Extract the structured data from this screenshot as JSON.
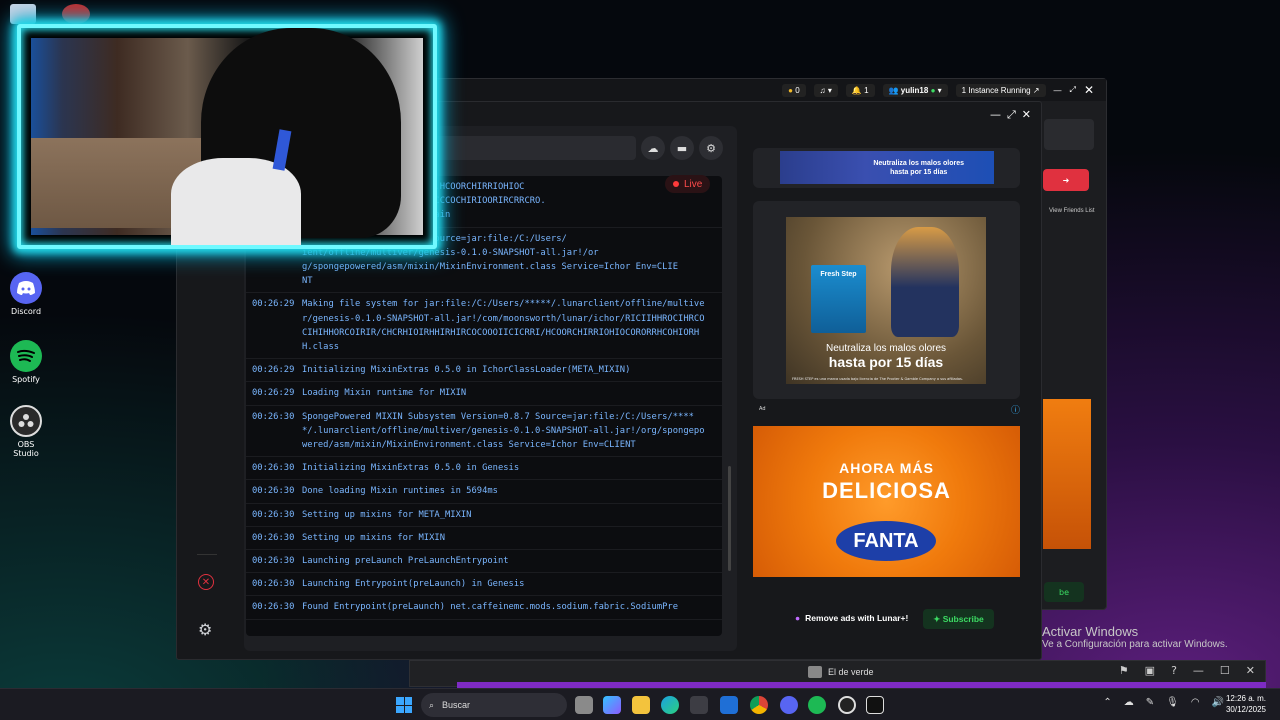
{
  "desktop": {
    "icons": [
      {
        "label": "Discord",
        "icon": "discord-icon",
        "color": "#5865f2"
      },
      {
        "label": "Spotify",
        "icon": "spotify-icon",
        "color": "#1db954"
      },
      {
        "label": "OBS Studio",
        "icon": "obs-icon",
        "color": "#2a2a2a"
      }
    ]
  },
  "back_window": {
    "coins": "0",
    "notifications": "1",
    "username": "yulin18",
    "instances": "1 Instance Running",
    "friends_link": "View Friends List",
    "subscribe_partial": "be"
  },
  "console": {
    "live_label": "Live",
    "logs": [
      {
        "time": "",
        "msg": "pl.moonsworth.lunar.ichor.HCOORCHIRRIOHIOC\nCHCHIROIRIIHHII.IROHHIROCCCCOCHIRIOORIRCRRCRO.\nHRCCIOO 564ms on thread main"
      },
      {
        "time": "",
        "msg": "Subsystem Version=0.8.7 Source=jar:file:/C:/Users/\nient/offline/multiver/genesis-0.1.0-SNAPSHOT-all.jar!/or\ng/spongepowered/asm/mixin/MixinEnvironment.class Service=Ichor Env=CLIE\nNT"
      },
      {
        "time": "00:26:29",
        "msg": "Making file system for jar:file:/C:/Users/*****/.lunarclient/offline/multiver/genesis-0.1.0-SNAPSHOT-all.jar!/com/moonsworth/lunar/ichor/RICIIHHROCIHRCOCIHIHHORCOIRIR/CHCRHIOIRHHIRHIRCOCOOOIICICRRI/HCOORCHIRRIOHIOCORORRHCOHIORHH.class"
      },
      {
        "time": "00:26:29",
        "msg": "Initializing MixinExtras 0.5.0 in IchorClassLoader(META_MIXIN)"
      },
      {
        "time": "00:26:29",
        "msg": "Loading Mixin runtime for MIXIN"
      },
      {
        "time": "00:26:30",
        "msg": "SpongePowered MIXIN Subsystem Version=0.8.7 Source=jar:file:/C:/Users/*****/.lunarclient/offline/multiver/genesis-0.1.0-SNAPSHOT-all.jar!/org/spongepowered/asm/mixin/MixinEnvironment.class Service=Ichor Env=CLIENT"
      },
      {
        "time": "00:26:30",
        "msg": "Initializing MixinExtras 0.5.0 in Genesis"
      },
      {
        "time": "00:26:30",
        "msg": "Done loading Mixin runtimes in 5694ms"
      },
      {
        "time": "00:26:30",
        "msg": "Setting up mixins for META_MIXIN"
      },
      {
        "time": "00:26:30",
        "msg": "Setting up mixins for MIXIN"
      },
      {
        "time": "00:26:30",
        "msg": "Launching preLaunch PreLaunchEntrypoint"
      },
      {
        "time": "00:26:30",
        "msg": "Launching Entrypoint(preLaunch) in Genesis"
      },
      {
        "time": "00:26:30",
        "msg": "Found Entrypoint(preLaunch) net.caffeinemc.mods.sodium.fabric.SodiumPre"
      }
    ]
  },
  "ads": {
    "banner_text": "Neutraliza los malos olores\nhasta por 15 días",
    "cat_brand": "Fresh Step",
    "cat_line1": "Neutraliza los malos olores",
    "cat_line2": "hasta por 15 días",
    "cat_legal": "FRESH STEP es una marca usada bajo licencia de The Procter & Gamble Company o sus afiliadas.",
    "ad_label": "Ad",
    "fanta_line1": "AHORA MÁS",
    "fanta_line2": "DELICIOSA",
    "fanta_logo": "FANTA",
    "remove_ads": "Remove ads with Lunar+!",
    "subscribe": "Subscribe"
  },
  "activate_windows": {
    "title": "Activar Windows",
    "subtitle": "Ve a Configuración para activar Windows."
  },
  "small_window": {
    "title": "El de verde"
  },
  "taskbar": {
    "search_placeholder": "Buscar",
    "time": "12:26 a. m.",
    "date": "30/12/2025"
  }
}
